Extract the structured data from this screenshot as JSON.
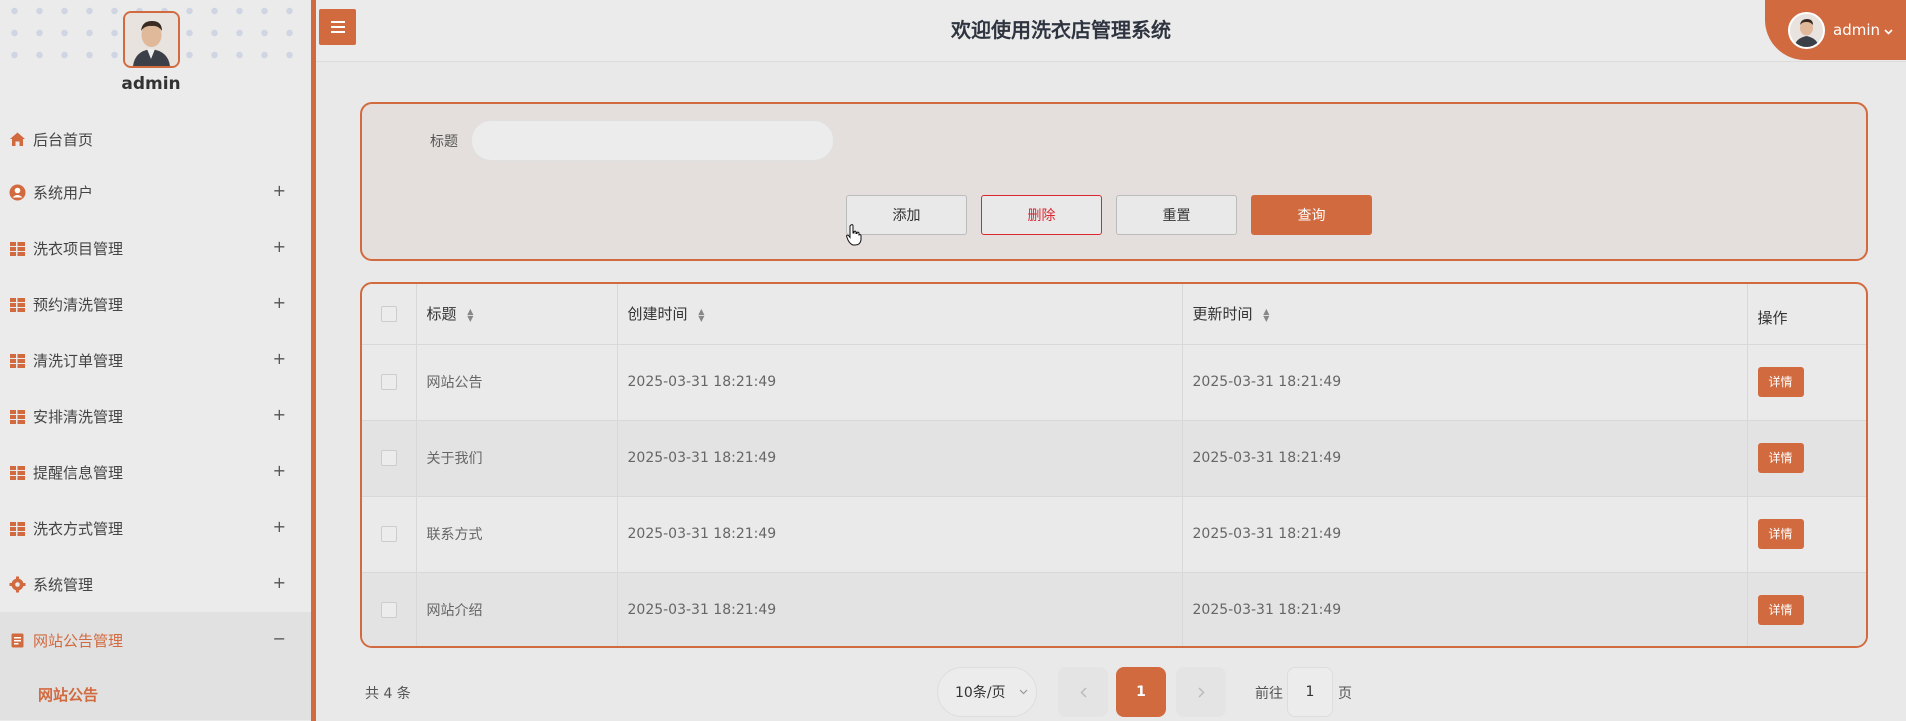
{
  "colors": {
    "accent": "#d26a3f",
    "danger": "#d9262f"
  },
  "sidebar": {
    "username": "admin",
    "items": [
      {
        "label": "后台首页",
        "icon": "home-icon",
        "expand": ""
      },
      {
        "label": "系统用户",
        "icon": "user-icon",
        "expand": "+"
      },
      {
        "label": "洗衣项目管理",
        "icon": "grid-icon",
        "expand": "+"
      },
      {
        "label": "预约清洗管理",
        "icon": "grid-icon",
        "expand": "+"
      },
      {
        "label": "清洗订单管理",
        "icon": "grid-icon",
        "expand": "+"
      },
      {
        "label": "安排清洗管理",
        "icon": "grid-icon",
        "expand": "+"
      },
      {
        "label": "提醒信息管理",
        "icon": "grid-icon",
        "expand": "+"
      },
      {
        "label": "洗衣方式管理",
        "icon": "grid-icon",
        "expand": "+"
      },
      {
        "label": "系统管理",
        "icon": "gear-icon",
        "expand": "+"
      },
      {
        "label": "网站公告管理",
        "icon": "document-icon",
        "expand": "−"
      }
    ],
    "subitem": "网站公告"
  },
  "header": {
    "title": "欢迎使用洗衣店管理系统",
    "user": "admin"
  },
  "search": {
    "label": "标题",
    "value": "",
    "buttons": {
      "add": "添加",
      "delete": "删除",
      "reset": "重置",
      "query": "查询"
    }
  },
  "table": {
    "headers": {
      "title": "标题",
      "created": "创建时间",
      "updated": "更新时间",
      "op": "操作"
    },
    "rows": [
      {
        "title": "网站公告",
        "created": "2025-03-31 18:21:49",
        "updated": "2025-03-31 18:21:49",
        "action": "详情"
      },
      {
        "title": "关于我们",
        "created": "2025-03-31 18:21:49",
        "updated": "2025-03-31 18:21:49",
        "action": "详情"
      },
      {
        "title": "联系方式",
        "created": "2025-03-31 18:21:49",
        "updated": "2025-03-31 18:21:49",
        "action": "详情"
      },
      {
        "title": "网站介绍",
        "created": "2025-03-31 18:21:49",
        "updated": "2025-03-31 18:21:49",
        "action": "详情"
      }
    ]
  },
  "pagination": {
    "total": "共 4 条",
    "page_size": "10条/页",
    "current_page": "1",
    "goto_label": "前往",
    "goto_value": "1",
    "page_suffix": "页"
  }
}
